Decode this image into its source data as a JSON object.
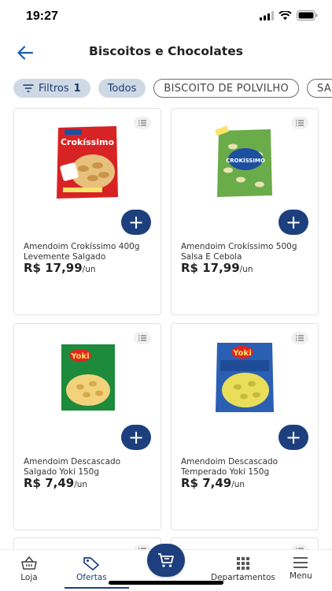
{
  "status_bar": {
    "time": "19:27"
  },
  "header": {
    "title": "Biscoitos e Chocolates"
  },
  "filters": {
    "filter_label": "Filtros",
    "filter_count": "1",
    "chips": [
      "Todos",
      "BISCOITO DE POLVILHO",
      "SA"
    ]
  },
  "products": [
    {
      "name": "Amendoim Crokíssimo 400g Levemente Salgado",
      "price": "R$ 17,99",
      "unit": "/un",
      "brand_text": "Crokíssimo",
      "color": "#d82324"
    },
    {
      "name": "Amendoim Crokíssimo 500g Salsa E Cebola",
      "price": "R$ 17,99",
      "unit": "/un",
      "brand_text": "CROKÍSSIMO",
      "color": "#4e9a3a"
    },
    {
      "name": "Amendoim Descascado Salgado Yoki 150g",
      "price": "R$ 7,49",
      "unit": "/un",
      "brand_text": "Yoki",
      "color": "#1d8a3c"
    },
    {
      "name": "Amendoim Descascado Temperado Yoki 150g",
      "price": "R$ 7,49",
      "unit": "/un",
      "brand_text": "Yoki",
      "color": "#2a5fb3"
    }
  ],
  "bottom_nav": {
    "items": [
      "Loja",
      "Ofertas",
      "Departamentos",
      "Menu"
    ]
  },
  "colors": {
    "primary": "#1d3f7e",
    "chip_bg": "#cfd9e6"
  }
}
